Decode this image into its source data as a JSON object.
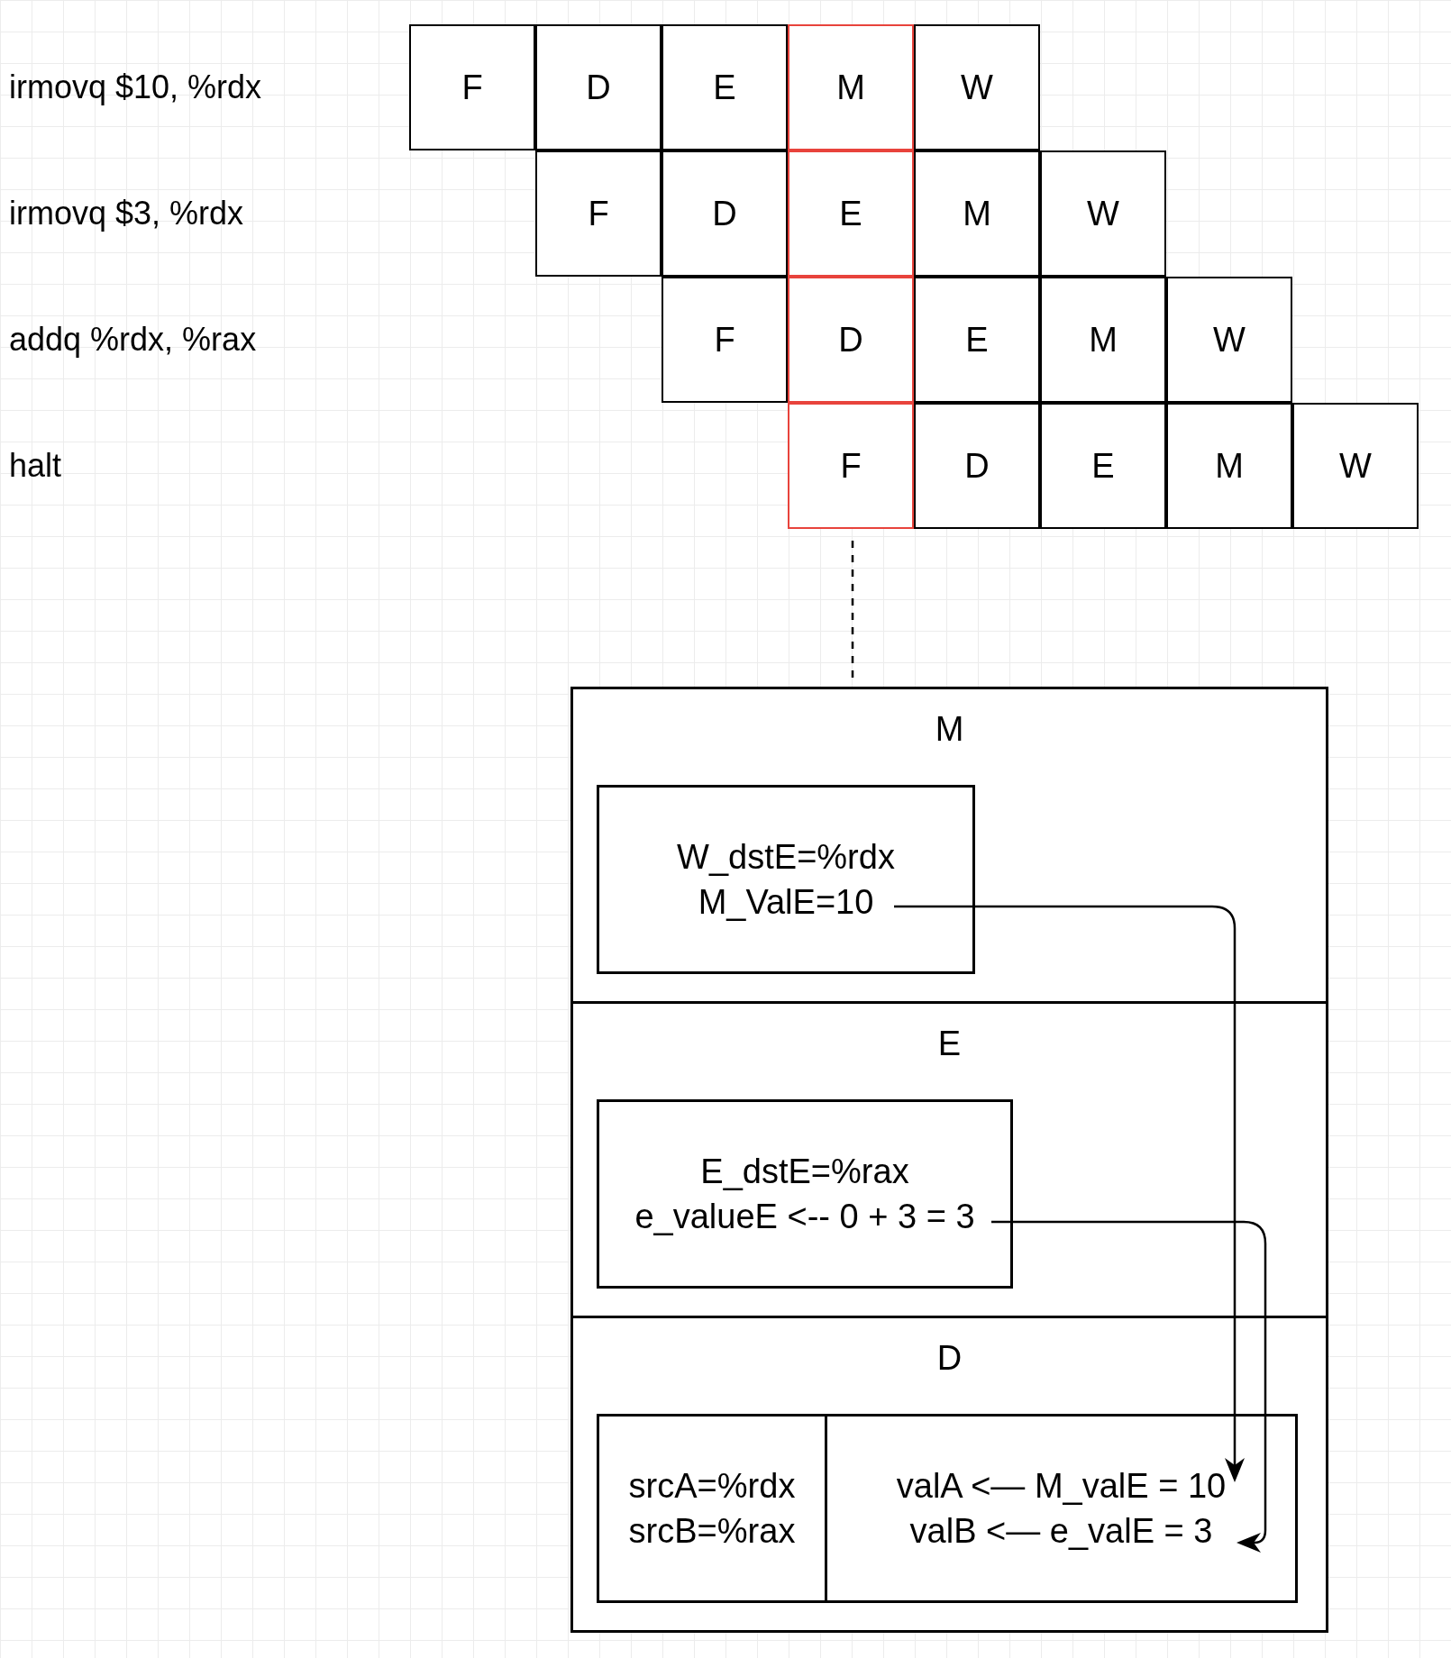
{
  "pipeline": {
    "rows": [
      {
        "instruction": "irmovq $10, %rdx",
        "stages": [
          {
            "label": "F",
            "highlighted": false
          },
          {
            "label": "D",
            "highlighted": false
          },
          {
            "label": "E",
            "highlighted": false
          },
          {
            "label": "M",
            "highlighted": true
          },
          {
            "label": "W",
            "highlighted": false
          }
        ]
      },
      {
        "instruction": "irmovq $3, %rdx",
        "stages": [
          {
            "label": "F",
            "highlighted": false
          },
          {
            "label": "D",
            "highlighted": false
          },
          {
            "label": "E",
            "highlighted": true
          },
          {
            "label": "M",
            "highlighted": false
          },
          {
            "label": "W",
            "highlighted": false
          }
        ]
      },
      {
        "instruction": "addq %rdx, %rax",
        "stages": [
          {
            "label": "F",
            "highlighted": false
          },
          {
            "label": "D",
            "highlighted": true
          },
          {
            "label": "E",
            "highlighted": false
          },
          {
            "label": "M",
            "highlighted": false
          },
          {
            "label": "W",
            "highlighted": false
          }
        ]
      },
      {
        "instruction": "halt",
        "stages": [
          {
            "label": "F",
            "highlighted": true
          },
          {
            "label": "D",
            "highlighted": false
          },
          {
            "label": "E",
            "highlighted": false
          },
          {
            "label": "M",
            "highlighted": false
          },
          {
            "label": "W",
            "highlighted": false
          }
        ]
      }
    ]
  },
  "detail": {
    "sections": [
      {
        "title": "M",
        "kind": "single",
        "lines": [
          "W_dstE=%rdx",
          "M_ValE=10"
        ]
      },
      {
        "title": "E",
        "kind": "single",
        "lines": [
          "E_dstE=%rax",
          "e_valueE <-- 0 + 3 = 3"
        ]
      },
      {
        "title": "D",
        "kind": "split",
        "left_lines": [
          "srcA=%rdx",
          "srcB=%rax"
        ],
        "right_lines": [
          "valA <— M_valE = 10",
          "valB <— e_valE = 3"
        ]
      }
    ]
  }
}
